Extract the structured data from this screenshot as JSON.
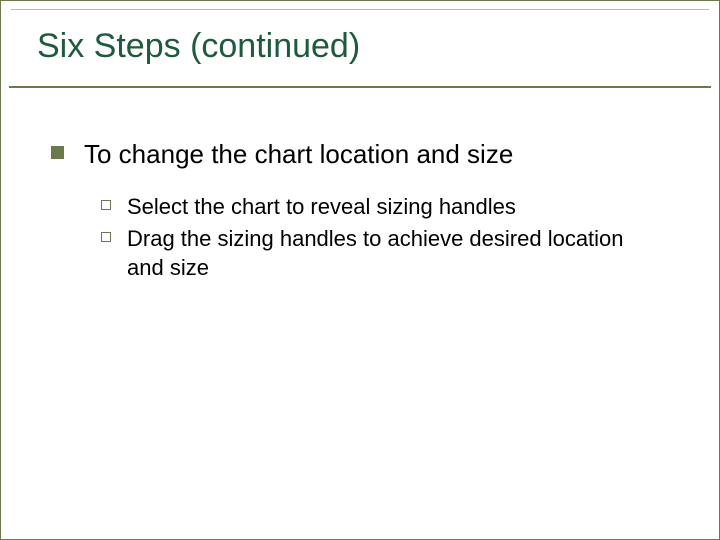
{
  "slide": {
    "title": "Six Steps (continued)",
    "main_point": {
      "text": "To change the chart location and size"
    },
    "sub_points": [
      {
        "text": "Select the chart to reveal sizing handles"
      },
      {
        "text": "Drag the sizing handles to achieve desired location and size"
      }
    ]
  }
}
